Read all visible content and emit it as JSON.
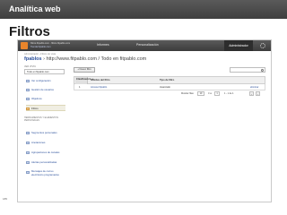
{
  "slide": {
    "header": "Analítica web",
    "heading": "Filtros",
    "number": "185"
  },
  "ga": {
    "account_line1": "filtros.fitpablo.com - filtros.fitpablo.com",
    "account_line2": "Tienda fitpablo.com",
    "nav": {
      "inicio": "Informes",
      "personal": "Personalización",
      "admin": "Administrador"
    },
    "breadcrumb": "Administrador › Filtros de vista",
    "page_title_bold": "fpablos",
    "page_title_rest": " › http://www.fitpablo.com / Todo en fitpablo.com",
    "sidebar": {
      "section_view": "Ver vista",
      "select_value": "Todo en fitpablo.com",
      "items": [
        {
          "label": "Ver configuración",
          "active": false
        },
        {
          "label": "Gestión de usuarios",
          "active": false
        },
        {
          "label": "Objetivos",
          "active": false
        },
        {
          "label": "Filtros",
          "active": true
        }
      ],
      "section_personal": "Herramientas y elementos personales",
      "personal_items": [
        {
          "label": "Segmentos personales",
          "active": false
        },
        {
          "label": "Anotaciones",
          "active": false
        },
        {
          "label": "Agrupaciones de canales",
          "active": false
        },
        {
          "label": "Alertas personalizadas",
          "active": false
        },
        {
          "label": "Mensajes de correo electrónico programados",
          "active": false
        }
      ]
    },
    "main": {
      "new_filter_button": "+ Nuevo filtro",
      "search_placeholder": "",
      "table": {
        "headers": {
          "rank": "Clasificación ▲",
          "name": "Nombre del filtro",
          "type": "Tipo de filtro"
        },
        "rows": [
          {
            "rank": "1",
            "name": "Acceso fitpablo",
            "type": "Avanzado",
            "action": "eliminar"
          }
        ]
      },
      "pager": {
        "rows_label": "Mostrar filas:",
        "rows_value": "10",
        "goto_label": "Ir a:",
        "goto_value": "1",
        "range": "1 - 1 de 1"
      }
    }
  }
}
